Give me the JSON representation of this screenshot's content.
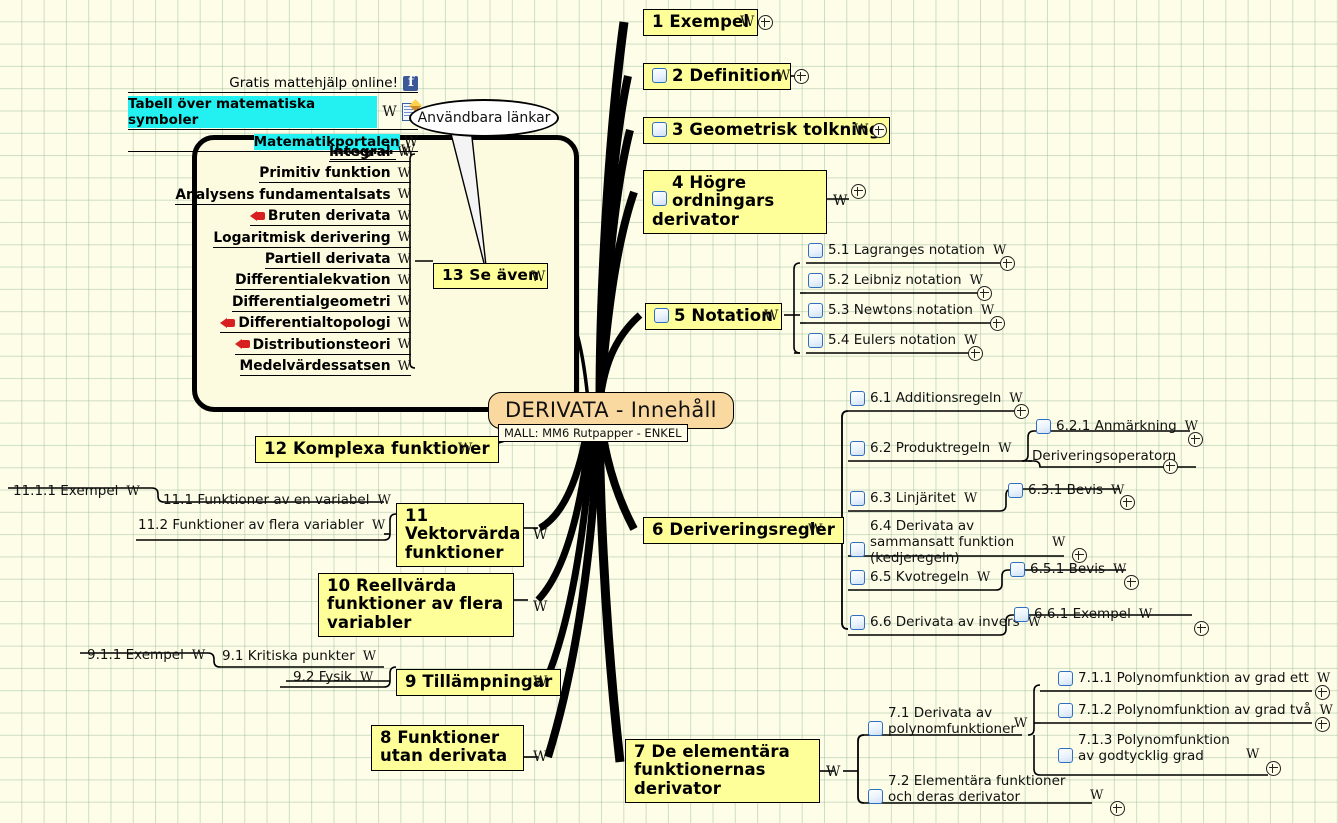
{
  "root": {
    "title": "DERIVATA -  Innehåll",
    "template_label": "MALL: MM6 Rutpapper - ENKEL"
  },
  "colors": {
    "topic_fill": "#ffff99",
    "root_fill": "#fad9a0",
    "background": "#fdfde8",
    "grid_line": "#96b996",
    "highlight": "#23f0f0",
    "checkbox_border": "#2f6fc0",
    "facebook_blue": "#3b5998",
    "red_arrow": "#d92020"
  },
  "callout": {
    "label": "Användbara länkar"
  },
  "links_group": {
    "items": [
      {
        "label": "Gratis mattehjälp online!",
        "highlight": false,
        "icons": [
          "facebook-icon"
        ]
      },
      {
        "label": "Tabell över matematiska symboler",
        "highlight": true,
        "icons": [
          "w-icon",
          "note-icon"
        ]
      },
      {
        "label": "Matematikportalen",
        "highlight": true,
        "icons": [
          "w-icon"
        ]
      }
    ]
  },
  "see_also": {
    "topic": "13 Se även",
    "topic_w": "W",
    "items": [
      {
        "label": "Integral",
        "w": "W",
        "arrow": false
      },
      {
        "label": "Primitiv funktion",
        "w": "W",
        "arrow": false
      },
      {
        "label": "Analysens fundamentalsats",
        "w": "W",
        "arrow": false
      },
      {
        "label": "Bruten derivata",
        "w": "W",
        "arrow": true
      },
      {
        "label": "Logaritmisk derivering",
        "w": "W",
        "arrow": false
      },
      {
        "label": "Partiell derivata",
        "w": "W",
        "arrow": false
      },
      {
        "label": "Differentialekvation",
        "w": "W",
        "arrow": false
      },
      {
        "label": "Differentialgeometri",
        "w": "W",
        "arrow": false
      },
      {
        "label": "Differentialtopologi",
        "w": "W",
        "arrow": true
      },
      {
        "label": "Distributionsteori",
        "w": "W",
        "arrow": true
      },
      {
        "label": "Medelvärdessatsen",
        "w": "W",
        "arrow": false
      }
    ]
  },
  "topics": {
    "t1": {
      "label": "1 Exempel",
      "w": "W",
      "checkbox": false
    },
    "t2": {
      "label": "2 Definition",
      "w": "W",
      "checkbox": true
    },
    "t3": {
      "label": "3 Geometrisk tolkning",
      "w": "W",
      "checkbox": true
    },
    "t4": {
      "label": "4 Högre ordningars derivator",
      "w": "W",
      "checkbox": true
    },
    "t5": {
      "label": "5 Notation",
      "w": "W",
      "checkbox": true
    },
    "t6": {
      "label": "6 Deriveringsregler",
      "w": "W",
      "checkbox": false
    },
    "t7": {
      "label": "7 De elementära funktionernas derivator",
      "w": "W",
      "checkbox": false
    },
    "t8": {
      "label": "8 Funktioner utan derivata",
      "w": "W",
      "checkbox": false
    },
    "t9": {
      "label": "9 Tillämpningar",
      "w": "W",
      "checkbox": false
    },
    "t10": {
      "label": "10 Reellvärda funktioner av flera variabler",
      "w": "W",
      "checkbox": false
    },
    "t11": {
      "label": "11 Vektorvärda funktioner",
      "w": "W",
      "checkbox": false
    },
    "t12": {
      "label": "12 Komplexa funktioner",
      "w": "W",
      "checkbox": false
    }
  },
  "notation_children": [
    {
      "label": "5.1 Lagranges notation",
      "w": "W",
      "checkbox": true
    },
    {
      "label": "5.2 Leibniz notation",
      "w": "W",
      "checkbox": true
    },
    {
      "label": "5.3 Newtons notation",
      "w": "W",
      "checkbox": true
    },
    {
      "label": "5.4 Eulers notation",
      "w": "W",
      "checkbox": true
    }
  ],
  "rules_children": [
    {
      "label": "6.1 Additionsregeln",
      "w": "W",
      "checkbox": true
    },
    {
      "label": "6.2 Produktregeln",
      "w": "W",
      "checkbox": true
    },
    {
      "label": "6.3 Linjäritet",
      "w": "W",
      "checkbox": true
    },
    {
      "label": "6.4 Derivata av sammansatt funktion (kedjeregeln)",
      "w": "W",
      "checkbox": true
    },
    {
      "label": "6.5 Kvotregeln",
      "w": "W",
      "checkbox": true
    },
    {
      "label": "6.6 Derivata av invers",
      "w": "W",
      "checkbox": true
    }
  ],
  "rules_grandchildren": {
    "c621": {
      "label": "6.2.1 Anmärkning",
      "w": "W",
      "checkbox": true
    },
    "c622": {
      "label": "Deriveringsoperatorn",
      "w": "",
      "checkbox": false
    },
    "c631": {
      "label": "6.3.1 Bevis",
      "w": "W",
      "checkbox": true
    },
    "c651": {
      "label": "6.5.1 Bevis",
      "w": "W",
      "checkbox": true
    },
    "c661": {
      "label": "6.6.1 Exempel",
      "w": "W",
      "checkbox": true
    }
  },
  "elementary_children": [
    {
      "label": "7.1 Derivata av polynomfunktioner",
      "w": "W",
      "checkbox": true
    },
    {
      "label": "7.2 Elementära funktioner och deras derivator",
      "w": "W",
      "checkbox": true
    }
  ],
  "elementary_grandchildren": [
    {
      "label": "7.1.1 Polynomfunktion av grad ett",
      "w": "W",
      "checkbox": true
    },
    {
      "label": "7.1.2 Polynomfunktion av grad två",
      "w": "W",
      "checkbox": true
    },
    {
      "label": "7.1.3 Polynomfunktion av godtycklig grad",
      "w": "W",
      "checkbox": true
    }
  ],
  "applications_children": [
    {
      "label": "9.1 Kritiska punkter",
      "w": "W"
    },
    {
      "label": "9.2 Fysik",
      "w": "W"
    }
  ],
  "applications_grandchildren": [
    {
      "label": "9.1.1 Exempel",
      "w": "W"
    }
  ],
  "vector_children": [
    {
      "label": "11.1 Funktioner av en variabel",
      "w": "W"
    },
    {
      "label": "11.2 Funktioner av flera variabler",
      "w": "W"
    }
  ],
  "vector_grandchildren": [
    {
      "label": "11.1.1 Exempel",
      "w": "W"
    }
  ]
}
